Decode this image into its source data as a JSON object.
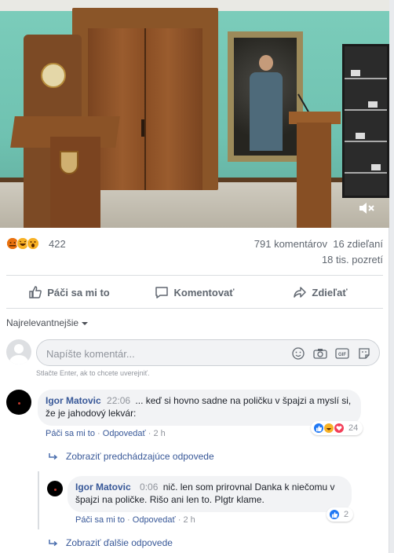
{
  "video": {
    "mute_icon": "speaker-muted-icon"
  },
  "stats": {
    "reaction_icons": [
      "angry-icon",
      "haha-icon",
      "wow-icon"
    ],
    "reaction_count": "422",
    "comments_shares": "791 komentárov  16 zdieľaní",
    "views": "18 tis. pozretí"
  },
  "actions": {
    "like": "Páči sa mi to",
    "comment": "Komentovať",
    "share": "Zdieľať"
  },
  "sort": {
    "label": "Najrelevantnejšie"
  },
  "compose": {
    "placeholder": "Napíšte komentár...",
    "hint": "Stlačte Enter, ak to chcete uverejniť."
  },
  "comments": [
    {
      "author": "Igor Matovic",
      "time": "22:06",
      "text": "... keď si hovno sadne na poličku v špajzi a myslí si, že je jahodový lekvár:",
      "like": "Páči sa mi to",
      "reply": "Odpovedať",
      "ago": "2 h",
      "reactions": [
        "like",
        "haha",
        "love"
      ],
      "reaction_count": "24"
    }
  ],
  "prev_replies": "Zobraziť predchádzajúce odpovede",
  "reply": {
    "author": "Igor Matovic",
    "time": "0:06",
    "text": "nič. len som prirovnal Danka k niečomu v špajzi na poličke. Rišo ani len to. Plgtr klame.",
    "like": "Páči sa mi to",
    "reply": "Odpovedať",
    "ago": "2 h",
    "reaction_count": "2"
  },
  "more_replies": "Zobraziť ďalšie odpovede"
}
